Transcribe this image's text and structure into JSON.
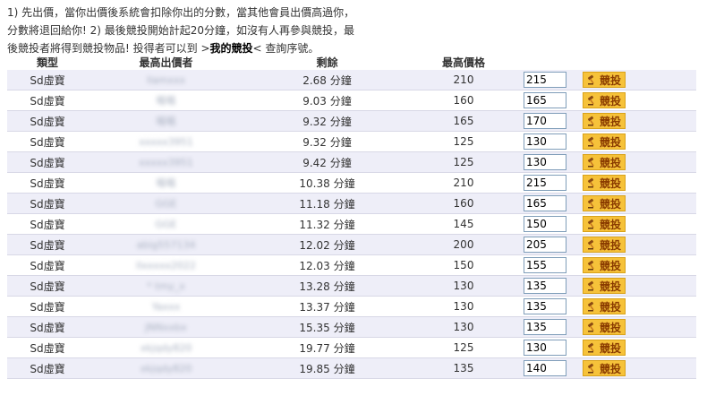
{
  "intro": {
    "line1": "1) 先出價，當你出價後系統會扣除你出的分數，當其他會員出價高過你，",
    "line2": "分數將退回給你! 2) 最後競投開始計起20分鐘，如沒有人再參與競投，最",
    "line3_prefix": "後競投者將得到競投物品! 投得者可以到 >",
    "line3_link": "我的競投",
    "line3_suffix": "< 查詢序號。"
  },
  "table": {
    "headers": {
      "type": "類型",
      "bidder": "最高出價者",
      "remaining": "剩餘",
      "price": "最高價格"
    },
    "bid_button_label": "競投",
    "rows": [
      {
        "type": "Sd虛寶",
        "bidder": "llamxxx",
        "remaining": "2.68 分鐘",
        "price": "210",
        "bid": "215"
      },
      {
        "type": "Sd虛寶",
        "bidder": "嘔嘔",
        "remaining": "9.03 分鐘",
        "price": "160",
        "bid": "165"
      },
      {
        "type": "Sd虛寶",
        "bidder": "嘔嘔",
        "remaining": "9.32 分鐘",
        "price": "165",
        "bid": "170"
      },
      {
        "type": "Sd虛寶",
        "bidder": "xxxxx3951",
        "remaining": "9.32 分鐘",
        "price": "125",
        "bid": "130"
      },
      {
        "type": "Sd虛寶",
        "bidder": "xxxxx3951",
        "remaining": "9.42 分鐘",
        "price": "125",
        "bid": "130"
      },
      {
        "type": "Sd虛寶",
        "bidder": "嘔嘔",
        "remaining": "10.38 分鐘",
        "price": "210",
        "bid": "215"
      },
      {
        "type": "Sd虛寶",
        "bidder": "GGE",
        "remaining": "11.18 分鐘",
        "price": "160",
        "bid": "165"
      },
      {
        "type": "Sd虛寶",
        "bidder": "GGE",
        "remaining": "11.32 分鐘",
        "price": "145",
        "bid": "150"
      },
      {
        "type": "Sd虛寶",
        "bidder": "abig557134",
        "remaining": "12.02 分鐘",
        "price": "200",
        "bid": "205"
      },
      {
        "type": "Sd虛寶",
        "bidder": "llxxxxx2022",
        "remaining": "12.03 分鐘",
        "price": "150",
        "bid": "155"
      },
      {
        "type": "Sd虛寶",
        "bidder": "* tmy_x",
        "remaining": "13.28 分鐘",
        "price": "130",
        "bid": "135"
      },
      {
        "type": "Sd虛寶",
        "bidder": "Yaxxx",
        "remaining": "13.37 分鐘",
        "price": "130",
        "bid": "135"
      },
      {
        "type": "Sd虛寶",
        "bidder": "JNNxxbx",
        "remaining": "15.35 分鐘",
        "price": "130",
        "bid": "135"
      },
      {
        "type": "Sd虛寶",
        "bidder": "xkjqdy820",
        "remaining": "19.77 分鐘",
        "price": "125",
        "bid": "130"
      },
      {
        "type": "Sd虛寶",
        "bidder": "xkjqdy820",
        "remaining": "19.85 分鐘",
        "price": "135",
        "bid": "140"
      }
    ]
  },
  "colors": {
    "row_alt": "#eeeef8",
    "button_bg": "#f6c23a",
    "button_text": "#8a3b00",
    "input_border": "#7f9db9"
  },
  "icons": {
    "bid_button": "gavel-icon"
  }
}
